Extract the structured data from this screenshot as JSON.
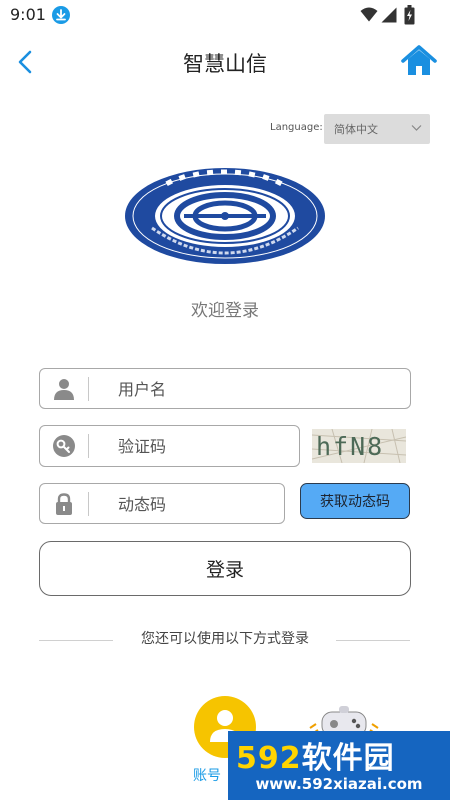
{
  "status_bar": {
    "time": "9:01"
  },
  "nav": {
    "title": "智慧山信"
  },
  "language": {
    "label": "Language:",
    "selected": "简体中文"
  },
  "welcome_text": "欢迎登录",
  "form": {
    "username_placeholder": "用户名",
    "captcha_placeholder": "验证码",
    "otp_placeholder": "动态码",
    "captcha_text": "hfN8",
    "get_otp_label": "获取动态码",
    "login_label": "登录"
  },
  "alternatives": {
    "text": "您还可以使用以下方式登录",
    "account_label": "账号"
  },
  "watermark": {
    "brand_num": "592",
    "brand_text": "软件园",
    "url": "www.592xiazai.com"
  },
  "colors": {
    "accent": "#1a9be6",
    "otp_button": "#55aaf5",
    "account_icon": "#f6c400",
    "watermark_bg": "#1565c0"
  },
  "icons": [
    "download-icon",
    "wifi-icon",
    "signal-icon",
    "battery-icon",
    "back-icon",
    "home-icon",
    "user-icon",
    "key-icon",
    "lock-icon",
    "chevron-down-icon",
    "game-controller-icon"
  ]
}
